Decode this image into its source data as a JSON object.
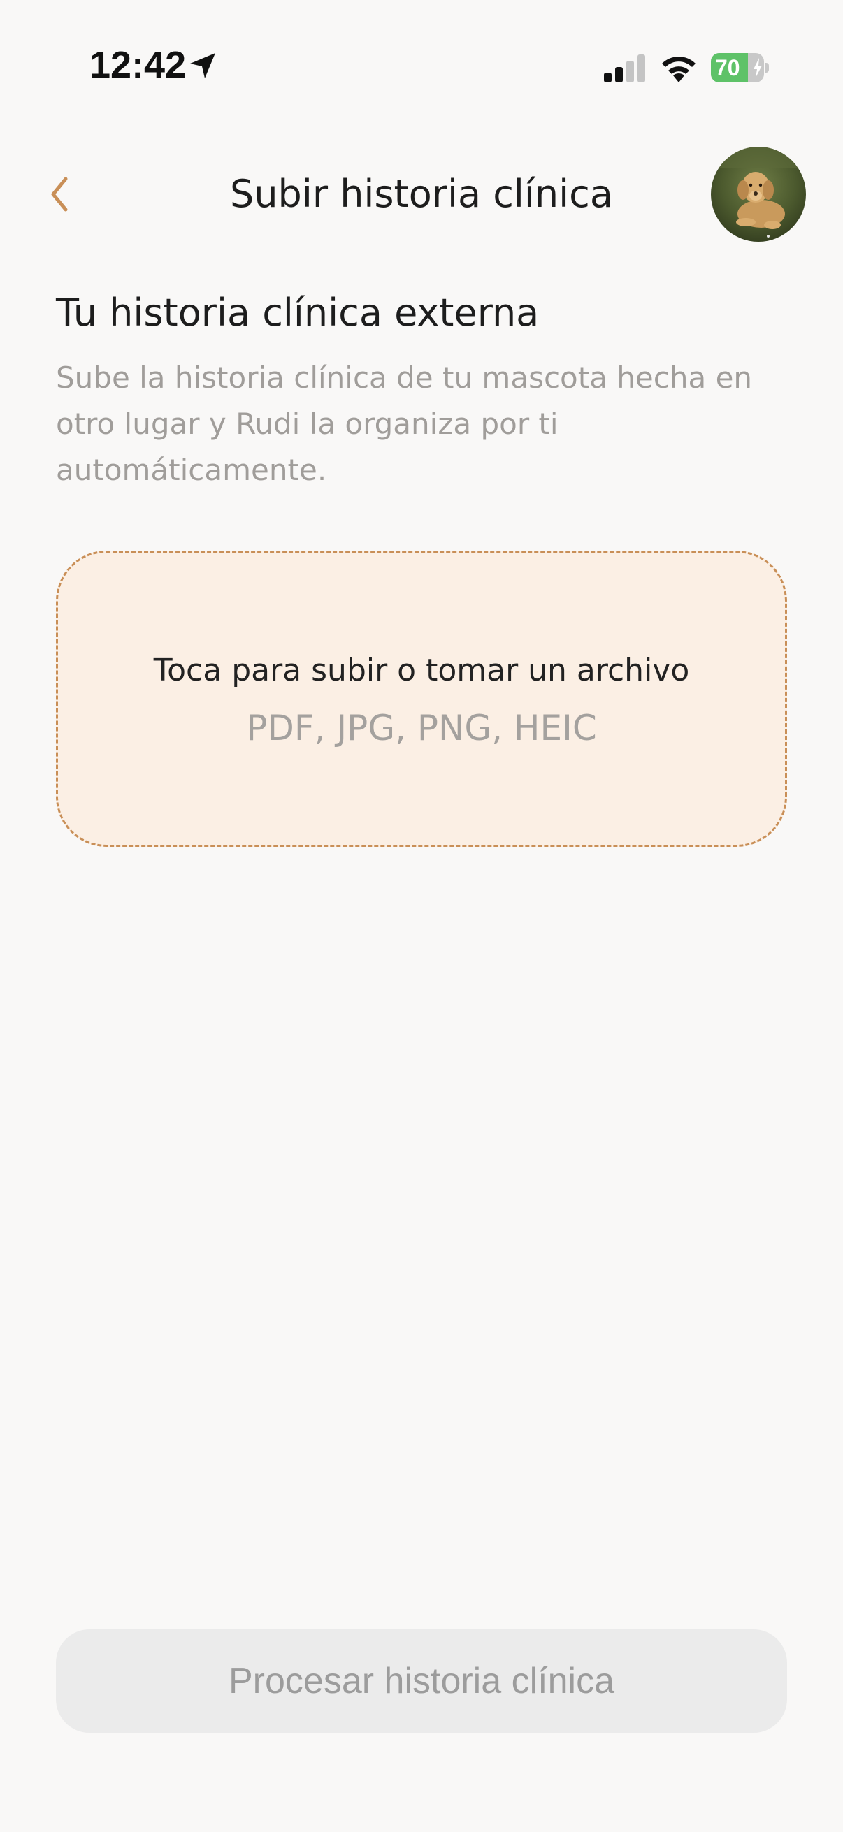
{
  "status_bar": {
    "time": "12:42",
    "battery_percent": "70",
    "battery_level": 0.7,
    "battery_charging": true,
    "signal_bars_active": 2,
    "signal_bars_total": 4,
    "icons": {
      "location": "location-arrow-icon",
      "signal": "cellular-signal-icon",
      "wifi": "wifi-icon",
      "battery": "battery-icon"
    }
  },
  "nav": {
    "title": "Subir historia clínica",
    "back_icon": "chevron-left-icon",
    "avatar": "pet-avatar"
  },
  "content": {
    "section_title": "Tu historia clínica externa",
    "section_description": "Sube la historia clínica de tu mascota hecha en otro lugar y Rudi la organiza por ti automáticamente.",
    "upload": {
      "label": "Toca para subir o tomar un archivo",
      "formats": "PDF, JPG, PNG, HEIC"
    }
  },
  "footer": {
    "process_button_label": "Procesar historia clínica",
    "process_button_enabled": false
  },
  "colors": {
    "accent": "#c98f57",
    "background": "#f9f8f7",
    "upload_background": "#fbefe4",
    "battery_green": "#5ec268",
    "disabled_button": "#ebebeb",
    "secondary_text": "#a09d9a"
  }
}
